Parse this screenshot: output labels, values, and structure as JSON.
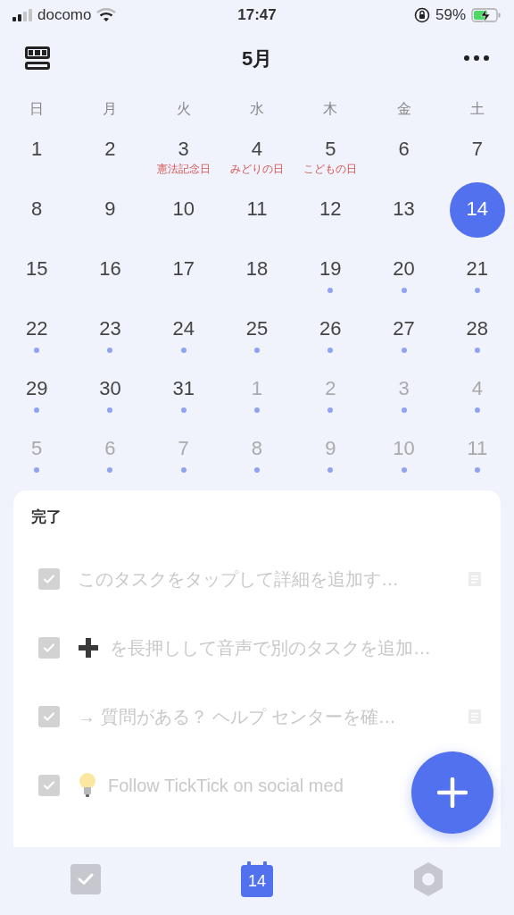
{
  "status_bar": {
    "carrier": "docomo",
    "time": "17:47",
    "battery": "59%"
  },
  "header": {
    "title": "5月"
  },
  "weekdays": [
    "日",
    "月",
    "火",
    "水",
    "木",
    "金",
    "土"
  ],
  "weeks": [
    [
      {
        "day": "1",
        "muted": false,
        "dot": false,
        "selected": false
      },
      {
        "day": "2",
        "muted": false,
        "dot": false,
        "selected": false
      },
      {
        "day": "3",
        "muted": false,
        "dot": false,
        "selected": false,
        "holiday": "憲法記念日"
      },
      {
        "day": "4",
        "muted": false,
        "dot": false,
        "selected": false,
        "holiday": "みどりの日"
      },
      {
        "day": "5",
        "muted": false,
        "dot": false,
        "selected": false,
        "holiday": "こどもの日"
      },
      {
        "day": "6",
        "muted": false,
        "dot": false,
        "selected": false
      },
      {
        "day": "7",
        "muted": false,
        "dot": false,
        "selected": false
      }
    ],
    [
      {
        "day": "8",
        "muted": false,
        "dot": false,
        "selected": false
      },
      {
        "day": "9",
        "muted": false,
        "dot": false,
        "selected": false
      },
      {
        "day": "10",
        "muted": false,
        "dot": false,
        "selected": false
      },
      {
        "day": "11",
        "muted": false,
        "dot": false,
        "selected": false
      },
      {
        "day": "12",
        "muted": false,
        "dot": false,
        "selected": false
      },
      {
        "day": "13",
        "muted": false,
        "dot": false,
        "selected": false
      },
      {
        "day": "14",
        "muted": false,
        "dot": false,
        "selected": true
      }
    ],
    [
      {
        "day": "15",
        "muted": false,
        "dot": false,
        "selected": false
      },
      {
        "day": "16",
        "muted": false,
        "dot": false,
        "selected": false
      },
      {
        "day": "17",
        "muted": false,
        "dot": false,
        "selected": false
      },
      {
        "day": "18",
        "muted": false,
        "dot": false,
        "selected": false
      },
      {
        "day": "19",
        "muted": false,
        "dot": true,
        "selected": false
      },
      {
        "day": "20",
        "muted": false,
        "dot": true,
        "selected": false
      },
      {
        "day": "21",
        "muted": false,
        "dot": true,
        "selected": false
      }
    ],
    [
      {
        "day": "22",
        "muted": false,
        "dot": true,
        "selected": false
      },
      {
        "day": "23",
        "muted": false,
        "dot": true,
        "selected": false
      },
      {
        "day": "24",
        "muted": false,
        "dot": true,
        "selected": false
      },
      {
        "day": "25",
        "muted": false,
        "dot": true,
        "selected": false
      },
      {
        "day": "26",
        "muted": false,
        "dot": true,
        "selected": false
      },
      {
        "day": "27",
        "muted": false,
        "dot": true,
        "selected": false
      },
      {
        "day": "28",
        "muted": false,
        "dot": true,
        "selected": false
      }
    ],
    [
      {
        "day": "29",
        "muted": false,
        "dot": true,
        "selected": false
      },
      {
        "day": "30",
        "muted": false,
        "dot": true,
        "selected": false
      },
      {
        "day": "31",
        "muted": false,
        "dot": true,
        "selected": false
      },
      {
        "day": "1",
        "muted": true,
        "dot": true,
        "selected": false
      },
      {
        "day": "2",
        "muted": true,
        "dot": true,
        "selected": false
      },
      {
        "day": "3",
        "muted": true,
        "dot": true,
        "selected": false
      },
      {
        "day": "4",
        "muted": true,
        "dot": true,
        "selected": false
      }
    ],
    [
      {
        "day": "5",
        "muted": true,
        "dot": true,
        "selected": false
      },
      {
        "day": "6",
        "muted": true,
        "dot": true,
        "selected": false
      },
      {
        "day": "7",
        "muted": true,
        "dot": true,
        "selected": false
      },
      {
        "day": "8",
        "muted": true,
        "dot": true,
        "selected": false
      },
      {
        "day": "9",
        "muted": true,
        "dot": true,
        "selected": false
      },
      {
        "day": "10",
        "muted": true,
        "dot": true,
        "selected": false
      },
      {
        "day": "11",
        "muted": true,
        "dot": true,
        "selected": false
      }
    ]
  ],
  "completed": {
    "title": "完了",
    "tasks": [
      {
        "kind": "plain",
        "text": "このタスクをタップして詳細を追加す…",
        "checked": true,
        "note": true
      },
      {
        "kind": "plus",
        "text": "を長押しして音声で別のタスクを追加…",
        "checked": true,
        "note": false
      },
      {
        "kind": "plain",
        "text": "→ 質問がある？ ヘルプ センターを確…",
        "checked": true,
        "note": true
      },
      {
        "kind": "bulb",
        "text": "Follow TickTick on social med",
        "checked": true,
        "note": false
      }
    ]
  },
  "tab_bar": [
    {
      "kind": "tasks",
      "selected": false
    },
    {
      "kind": "calendar",
      "label": "14",
      "selected": true
    },
    {
      "kind": "settings",
      "selected": false
    }
  ]
}
